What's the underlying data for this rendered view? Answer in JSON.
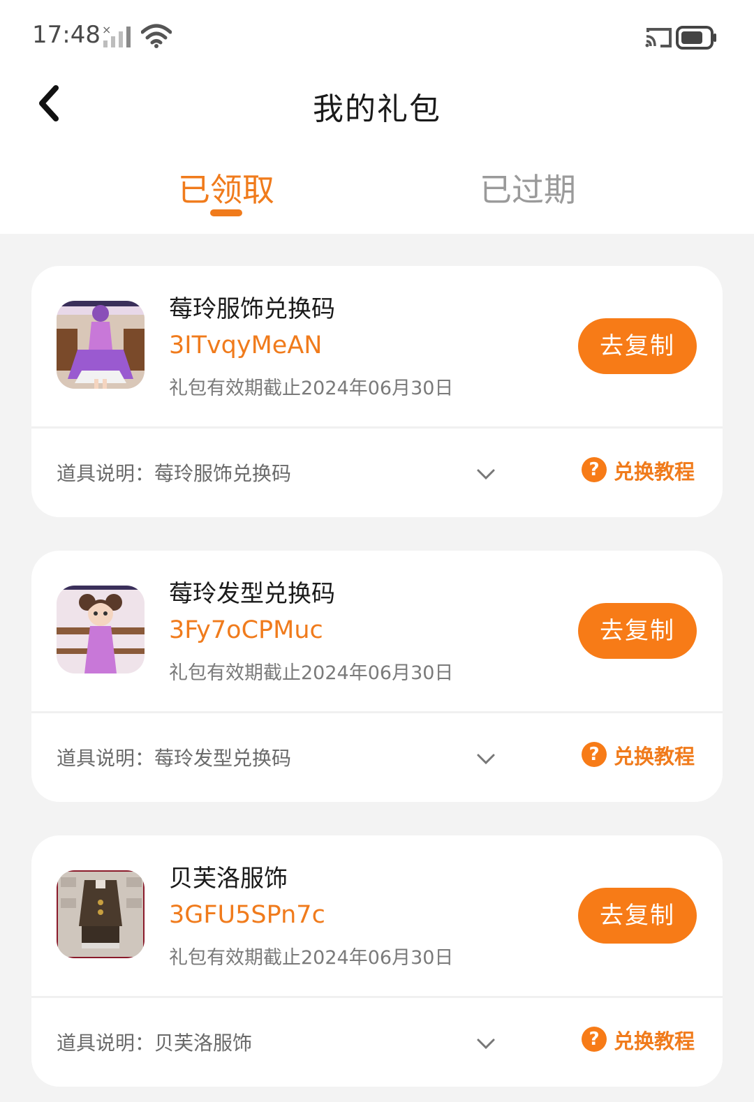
{
  "status_bar": {
    "time": "17:48"
  },
  "header": {
    "title": "我的礼包",
    "tabs": [
      {
        "label": "已领取",
        "active": true
      },
      {
        "label": "已过期",
        "active": false
      }
    ]
  },
  "colors": {
    "accent": "#f07b1c",
    "button": "#f77b17",
    "background": "#f3f3f3"
  },
  "gifts": [
    {
      "name": "莓玲服饰兑换码",
      "code": "3ITvqyMeAN",
      "expire": "礼包有效期截止2024年06月30日",
      "copy_label": "去复制",
      "desc": "道具说明：莓玲服饰兑换码",
      "guide_label": "兑换教程",
      "thumb_icon": "game-character-dress-thumbnail"
    },
    {
      "name": "莓玲发型兑换码",
      "code": "3Fy7oCPMuc",
      "expire": "礼包有效期截止2024年06月30日",
      "copy_label": "去复制",
      "desc": "道具说明：莓玲发型兑换码",
      "guide_label": "兑换教程",
      "thumb_icon": "game-character-hair-thumbnail"
    },
    {
      "name": "贝芙洛服饰",
      "code": "3GFU5SPn7c",
      "expire": "礼包有效期截止2024年06月30日",
      "copy_label": "去复制",
      "desc": "道具说明：贝芙洛服饰",
      "guide_label": "兑换教程",
      "thumb_icon": "game-outfit-thumbnail"
    }
  ]
}
